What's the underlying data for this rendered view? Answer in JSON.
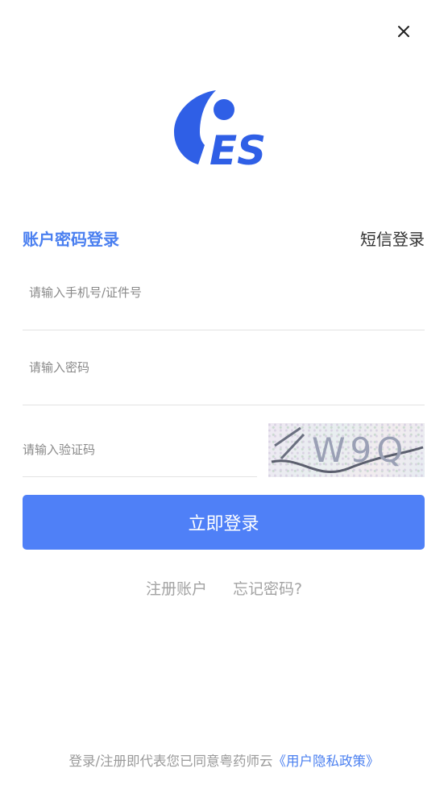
{
  "tabs": {
    "password_login": "账户密码登录",
    "sms_login": "短信登录"
  },
  "form": {
    "account_placeholder": "请输入手机号/证件号",
    "password_placeholder": "请输入密码",
    "captcha_placeholder": "请输入验证码",
    "captcha_text": "W9Q"
  },
  "login_button_label": "立即登录",
  "links": {
    "register": "注册账户",
    "forgot_password": "忘记密码?"
  },
  "agreement": {
    "prefix": "登录/注册即代表您已同意粤药师云",
    "policy_link": "《用户隐私政策》"
  },
  "logo_text": "ES",
  "colors": {
    "accent": "#4f80f7",
    "link": "#4a7ff0",
    "logo": "#2f5fe6"
  },
  "icons": {
    "close": "close-icon"
  }
}
